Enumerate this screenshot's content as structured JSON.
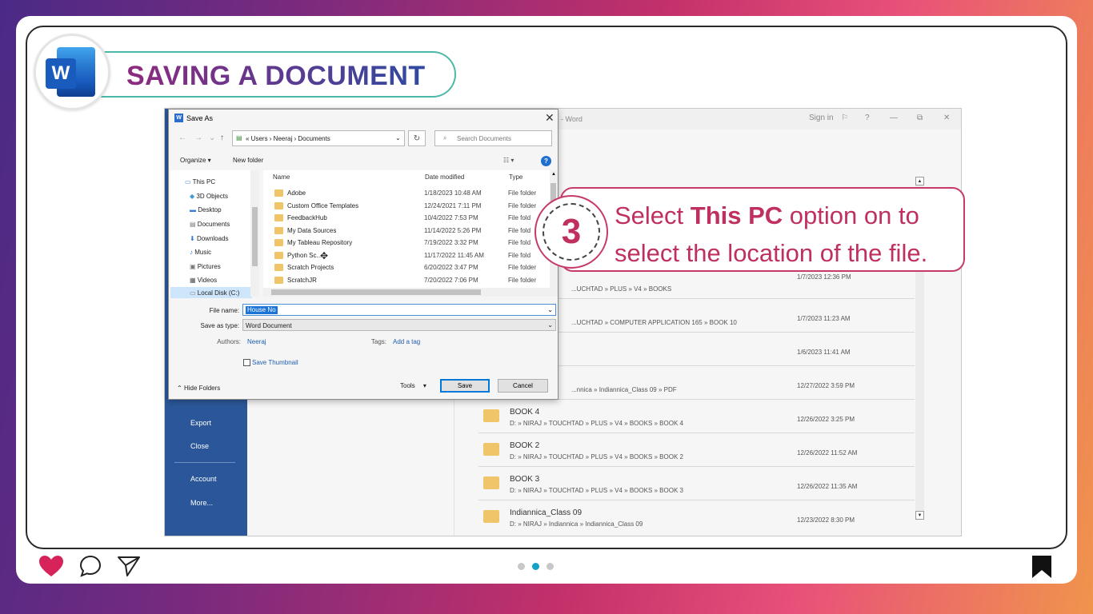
{
  "header": {
    "title": "SAVING A DOCUMENT",
    "logo_letter": "W"
  },
  "word_window": {
    "title": "...t! - Word",
    "sign_in": "Sign in",
    "controls": [
      "?",
      "—",
      "⧉",
      "✕"
    ],
    "sidebar": [
      "Export",
      "Close",
      "Account",
      "More..."
    ],
    "recent_rows": [
      {
        "name": "",
        "path": "...UCHTAD » PLUS » V4 » BOOKS",
        "date": "1/7/2023 12:36 PM"
      },
      {
        "name": "",
        "path": "...UCHTAD » COMPUTER APPLICATION 165 » BOOK 10",
        "date": "1/7/2023 11:23 AM"
      },
      {
        "name": "",
        "path": "",
        "date": "1/6/2023 11:41 AM"
      },
      {
        "name": "",
        "path": "...nnica » Indiannica_Class 09 » PDF",
        "date": "12/27/2022 3:59 PM"
      },
      {
        "name": "BOOK 4",
        "path": "D: » NIRAJ » TOUCHTAD » PLUS » V4 » BOOKS » BOOK 4",
        "date": "12/26/2022 3:25 PM"
      },
      {
        "name": "BOOK 2",
        "path": "D: » NIRAJ » TOUCHTAD » PLUS » V4 » BOOKS » BOOK 2",
        "date": "12/26/2022 11:52 AM"
      },
      {
        "name": "BOOK 3",
        "path": "D: » NIRAJ » TOUCHTAD » PLUS » V4 » BOOKS » BOOK 3",
        "date": "12/26/2022 11:35 AM"
      },
      {
        "name": "Indiannica_Class 09",
        "path": "D: » NIRAJ » Indiannica » Indiannica_Class 09",
        "date": "12/23/2022 8:30 PM"
      }
    ]
  },
  "dialog": {
    "title": "Save As",
    "address": "«  Users  ›  Neeraj  ›  Documents",
    "search_placeholder": "Search Documents",
    "organize": "Organize ▾",
    "new_folder": "New folder",
    "view": "☷ ▾",
    "tree": [
      "This PC",
      "3D Objects",
      "Desktop",
      "Documents",
      "Downloads",
      "Music",
      "Pictures",
      "Videos",
      "Local Disk (C:)"
    ],
    "columns": {
      "name": "Name",
      "date": "Date modified",
      "type": "Type"
    },
    "files": [
      {
        "name": "Adobe",
        "date": "1/18/2023 10:48 AM",
        "type": "File folder"
      },
      {
        "name": "Custom Office Templates",
        "date": "12/24/2021 7:11 PM",
        "type": "File folder"
      },
      {
        "name": "FeedbackHub",
        "date": "10/4/2022 7:53 PM",
        "type": "File fold"
      },
      {
        "name": "My Data Sources",
        "date": "11/14/2022 5:26 PM",
        "type": "File fold"
      },
      {
        "name": "My Tableau Repository",
        "date": "7/19/2022 3:32 PM",
        "type": "File fold"
      },
      {
        "name": "Python Sc...",
        "date": "11/17/2022 11:45 AM",
        "type": "File fold"
      },
      {
        "name": "Scratch Projects",
        "date": "6/20/2022 3:47 PM",
        "type": "File folder"
      },
      {
        "name": "ScratchJR",
        "date": "7/20/2022 7:06 PM",
        "type": "File folder"
      }
    ],
    "file_name_label": "File name:",
    "file_name_value": "House No",
    "save_type_label": "Save as type:",
    "save_type_value": "Word Document",
    "authors_label": "Authors:",
    "authors_value": "Neeraj",
    "tags_label": "Tags:",
    "tags_value": "Add a tag",
    "thumbnail_label": "Save Thumbnail",
    "hide_folders": "Hide Folders",
    "tools": "Tools",
    "save": "Save",
    "cancel": "Cancel"
  },
  "callout": {
    "step": "3",
    "text_pre": "Select ",
    "text_bold": "This PC",
    "text_post": " option on to select the location of the file."
  },
  "colors": {
    "accent": "#c0305e",
    "word_blue": "#2b579a"
  }
}
